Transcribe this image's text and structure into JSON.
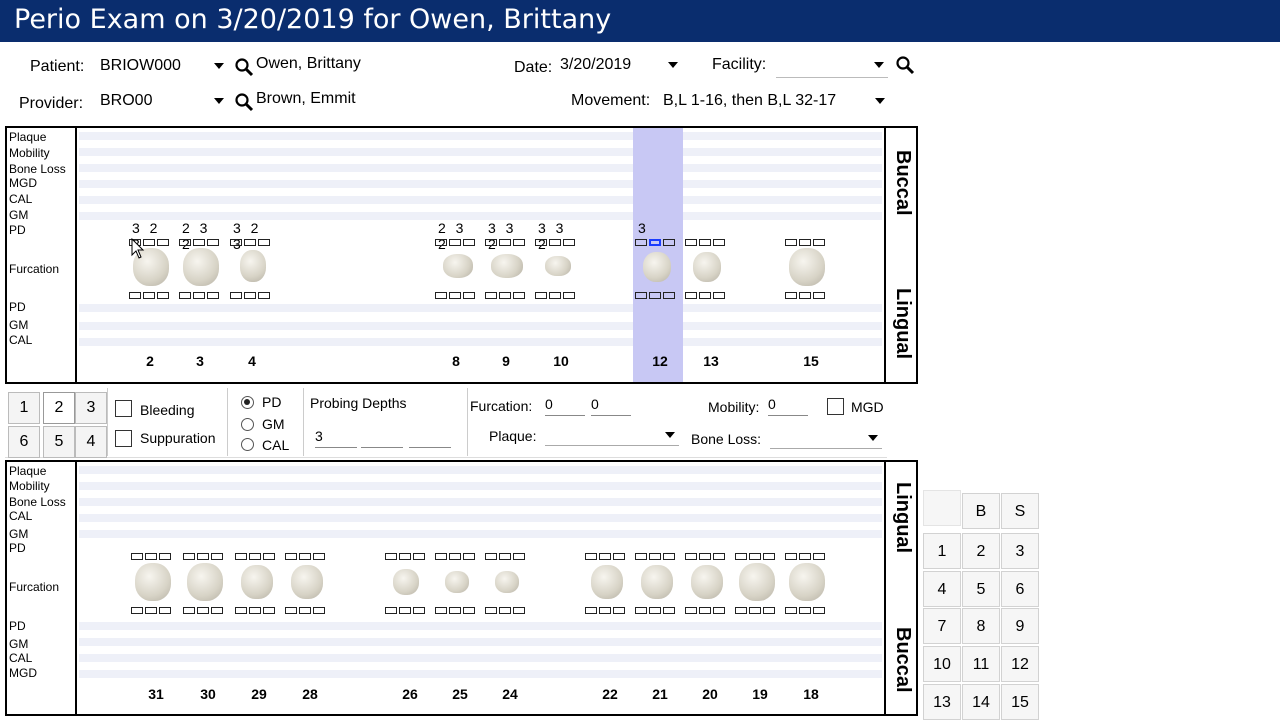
{
  "title": "Perio Exam on 3/20/2019 for Owen, Brittany",
  "header": {
    "patient_label": "Patient:",
    "patient_id": "BRIOW000",
    "patient_name": "Owen, Brittany",
    "provider_label": "Provider:",
    "provider_id": "BRO00",
    "provider_name": "Brown, Emmit",
    "date_label": "Date:",
    "date_value": "3/20/2019",
    "facility_label": "Facility:",
    "facility_value": "",
    "movement_label": "Movement:",
    "movement_value": "B,L 1-16, then B,L 32-17"
  },
  "upper_chart": {
    "row_labels_top": [
      "Plaque",
      "Mobility",
      "Bone Loss",
      "MGD",
      "CAL",
      "GM",
      "PD"
    ],
    "furcation_label": "Furcation",
    "row_labels_bottom": [
      "PD",
      "GM",
      "CAL"
    ],
    "side_top": "Buccal",
    "side_bottom": "Lingual",
    "teeth": [
      {
        "num": "2",
        "pd": "3 2 3"
      },
      {
        "num": "3",
        "pd": "2 3 2"
      },
      {
        "num": "4",
        "pd": "3 2 3"
      },
      {
        "num": "8",
        "pd": "2 3 2"
      },
      {
        "num": "9",
        "pd": "3 3 2"
      },
      {
        "num": "10",
        "pd": "3 3 2"
      },
      {
        "num": "12",
        "pd": "3"
      },
      {
        "num": "13",
        "pd": ""
      },
      {
        "num": "15",
        "pd": ""
      }
    ],
    "selected_tooth": "12"
  },
  "controls": {
    "site_buttons": [
      "1",
      "2",
      "3",
      "6",
      "5",
      "4"
    ],
    "selected_site": "2",
    "bleeding_label": "Bleeding",
    "suppuration_label": "Suppuration",
    "radio_pd": "PD",
    "radio_gm": "GM",
    "radio_cal": "CAL",
    "probing_label": "Probing Depths",
    "probing_values": [
      "3",
      "",
      ""
    ],
    "furcation_label": "Furcation:",
    "furcation_values": [
      "0",
      "0"
    ],
    "plaque_label": "Plaque:",
    "plaque_value": "",
    "mobility_label": "Mobility:",
    "mobility_value": "0",
    "mgd_label": "MGD",
    "bone_loss_label": "Bone Loss:",
    "bone_loss_value": ""
  },
  "lower_chart": {
    "row_labels_top": [
      "Plaque",
      "Mobility",
      "Bone Loss",
      "CAL",
      "GM",
      "PD"
    ],
    "furcation_label": "Furcation",
    "row_labels_bottom": [
      "PD",
      "GM",
      "CAL",
      "MGD"
    ],
    "side_top": "Lingual",
    "side_bottom": "Buccal",
    "teeth": [
      "31",
      "30",
      "29",
      "28",
      "26",
      "25",
      "24",
      "22",
      "21",
      "20",
      "19",
      "18"
    ]
  },
  "keypad": {
    "headers": [
      "B",
      "S"
    ],
    "keys": [
      "1",
      "2",
      "3",
      "4",
      "5",
      "6",
      "7",
      "8",
      "9",
      "10",
      "11",
      "12",
      "13",
      "14",
      "15"
    ]
  }
}
